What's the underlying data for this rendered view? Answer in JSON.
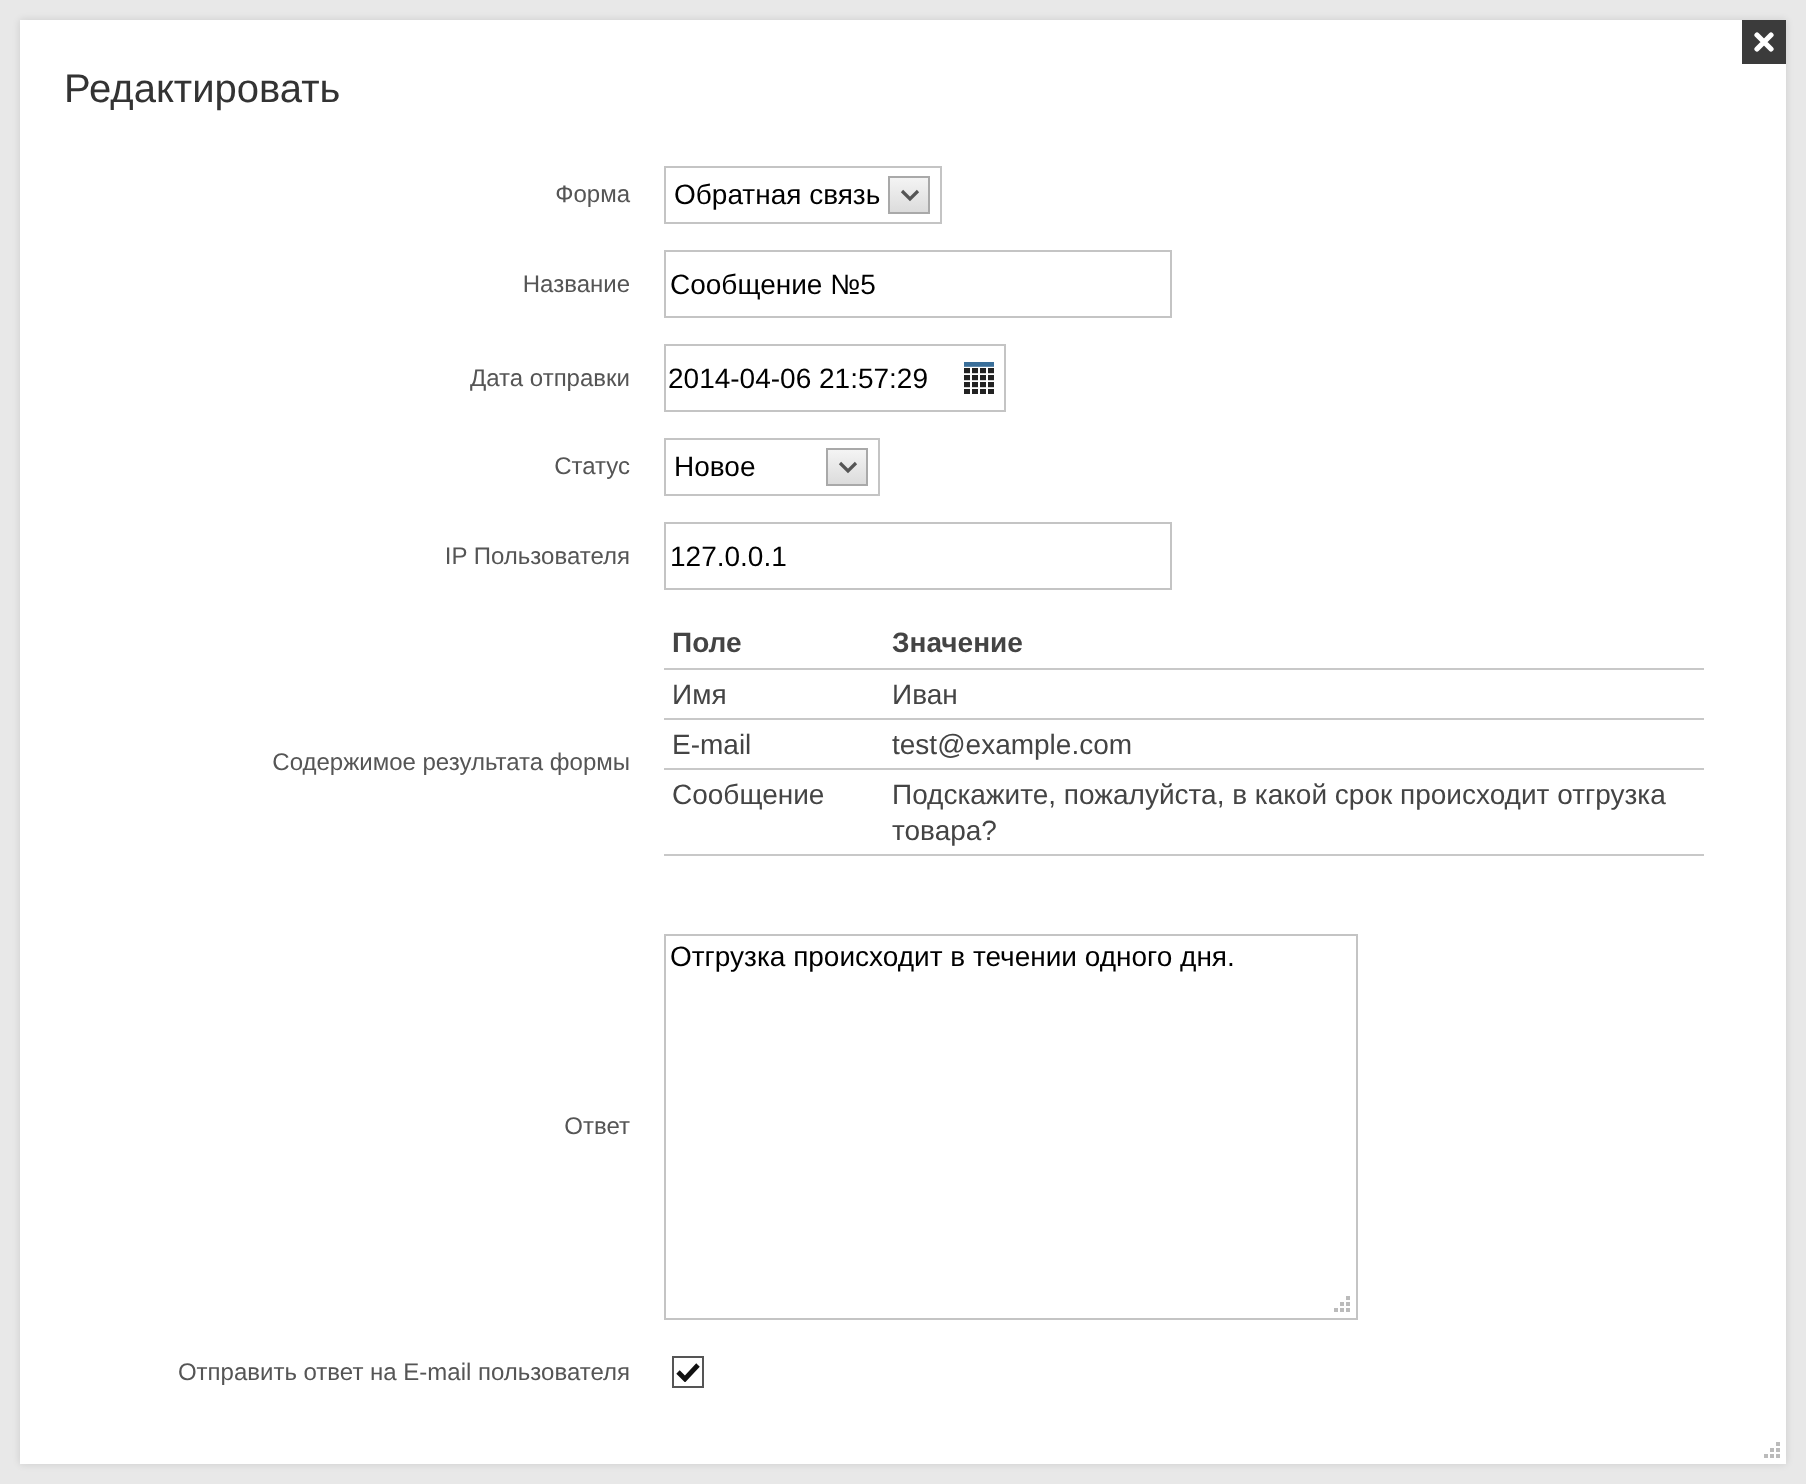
{
  "dialog": {
    "title": "Редактировать"
  },
  "fields": [
    {
      "kind": "select",
      "label": "Форма",
      "value": "Обратная связь"
    },
    {
      "kind": "text",
      "label": "Название",
      "value": "Сообщение №5"
    },
    {
      "kind": "datetime",
      "label": "Дата отправки",
      "value": "2014-04-06 21:57:29"
    },
    {
      "kind": "select",
      "label": "Статус",
      "value": "Новое"
    },
    {
      "kind": "text",
      "label": "IP Пользователя",
      "value": "127.0.0.1"
    },
    {
      "kind": "table",
      "label": "Содержимое результата формы",
      "columns": [
        "Поле",
        "Значение"
      ],
      "rows": [
        [
          "Имя",
          "Иван"
        ],
        [
          "E-mail",
          "test@example.com"
        ],
        [
          "Сообщение",
          "Подскажите, пожалуйста, в какой срок происходит отгрузка товара?"
        ]
      ]
    },
    {
      "kind": "textarea",
      "label": "Ответ",
      "value": "Отгрузка происходит в течении одного дня."
    },
    {
      "kind": "checkbox",
      "label": "Отправить ответ на E-mail пользователя",
      "checked": true
    }
  ]
}
